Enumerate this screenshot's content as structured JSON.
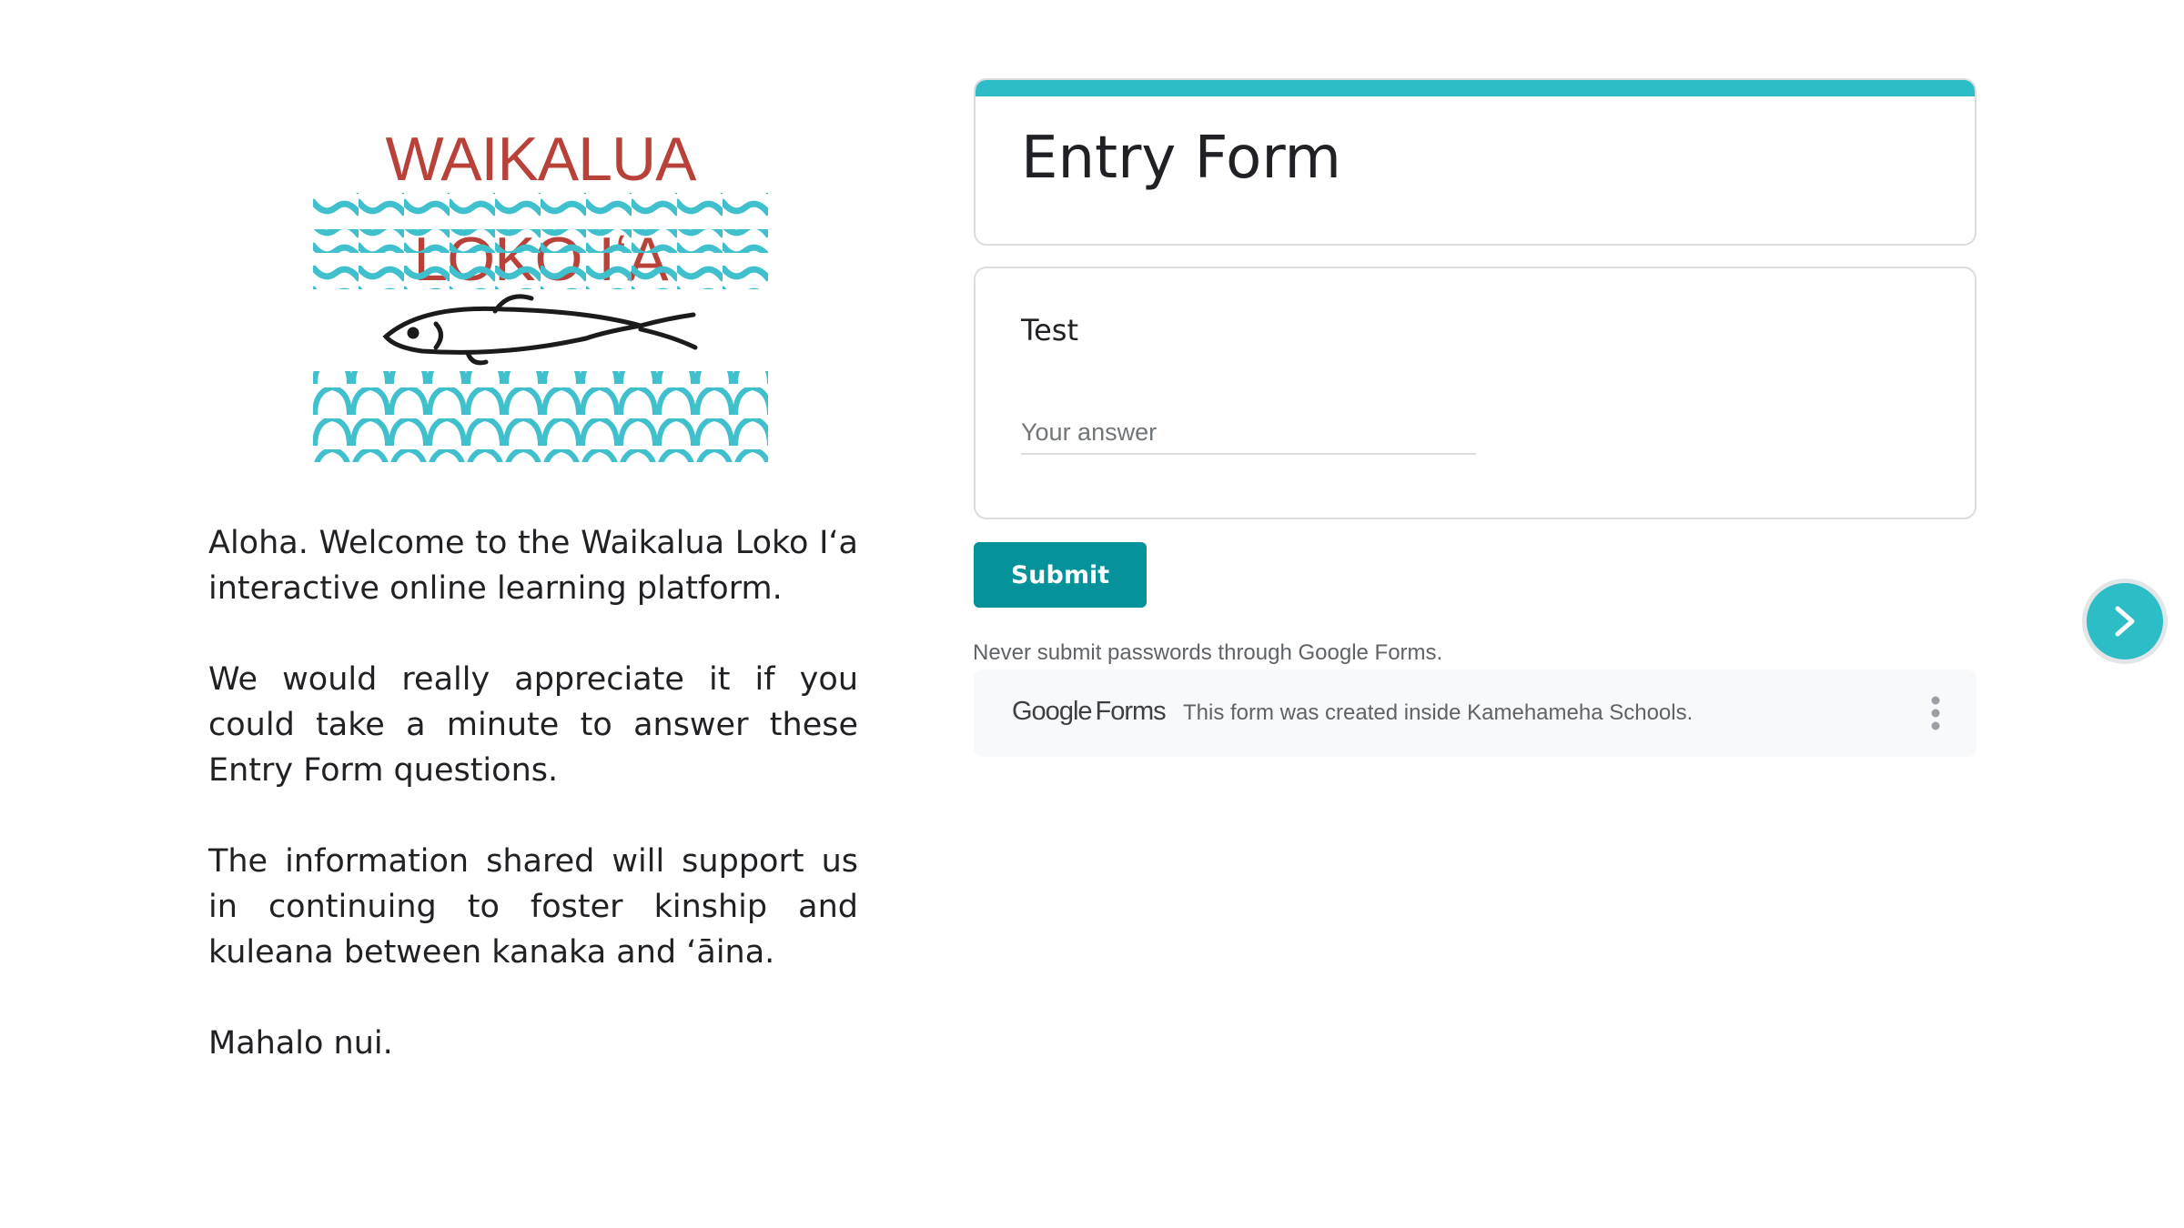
{
  "logo": {
    "title": "WAIKALUA LOKO IʻA"
  },
  "intro": {
    "paragraphs": [
      "Aloha. Welcome to the Waikalua Loko Iʻa interactive online learning platform.",
      "We would really appreciate it if you could take a minute to answer these Entry Form questions.",
      "The information shared will support us in continuing to foster kinship and kuleana between kanaka and ʻāina.",
      "Mahalo nui."
    ]
  },
  "form": {
    "title": "Entry Form",
    "accent_color": "#2dbdc6",
    "question": {
      "label": "Test",
      "placeholder": "Your answer",
      "value": ""
    },
    "submit_label": "Submit",
    "submit_color": "#06929b",
    "warning": "Never submit passwords through Google Forms.",
    "footer": {
      "brand_google": "Google",
      "brand_forms": "Forms",
      "text": "This form was created inside Kamehameha Schools.",
      "more_icon": "more-vert-icon"
    }
  },
  "navigation": {
    "next_icon": "chevron-right-icon",
    "color": "#2dbdc6"
  }
}
